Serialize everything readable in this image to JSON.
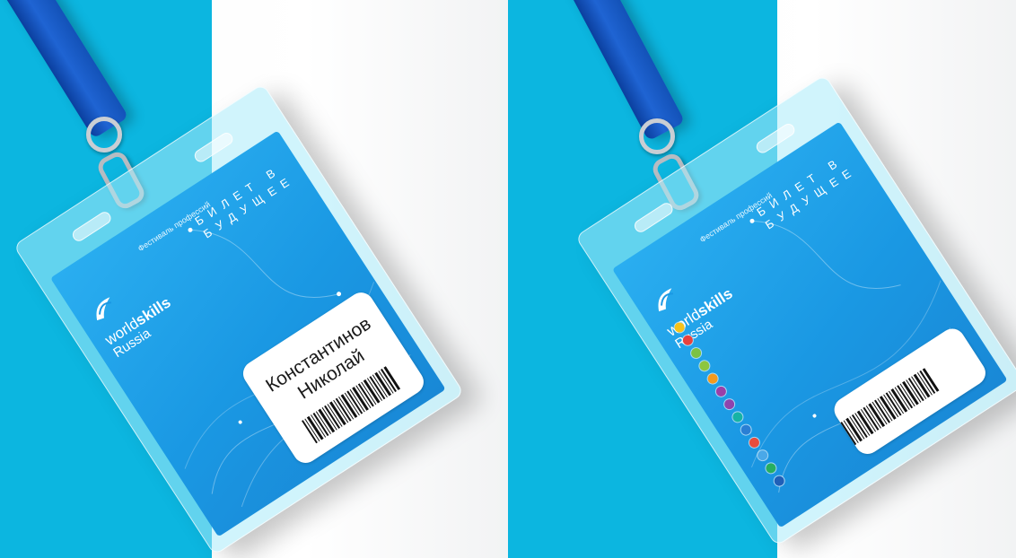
{
  "badges": [
    {
      "org_name_light": "world",
      "org_name_bold": "skills",
      "org_country": "Russia",
      "festival_text": "Фестиваль профессий",
      "ticket_line1": "БИЛЕТ В",
      "ticket_line2": "БУДУЩЕЕ",
      "holder_last_name": "Константинов",
      "holder_first_name": "Николай"
    },
    {
      "org_name_light": "world",
      "org_name_bold": "skills",
      "org_country": "Russia",
      "festival_text": "Фестиваль профессий",
      "ticket_line1": "БИЛЕТ В",
      "ticket_line2": "БУДУЩЕЕ",
      "skill_icons": [
        "yellow-circle-icon",
        "red-circle-icon",
        "green-circle-icon",
        "lime-circle-icon",
        "orange-circle-icon",
        "purple-circle-icon",
        "violet-circle-icon",
        "teal-circle-icon",
        "blue-circle-icon",
        "red-orange-circle-icon",
        "light-blue-circle-icon",
        "green-teal-circle-icon",
        "navy-circle-icon"
      ],
      "skill_colors": [
        "#f6c21b",
        "#e8423d",
        "#7cc242",
        "#8dc63f",
        "#f39a1e",
        "#9b3fa8",
        "#8e44ad",
        "#16b3a4",
        "#2a7fd4",
        "#e74c3c",
        "#4aa8e8",
        "#27ae60",
        "#1f5fb8"
      ]
    }
  ],
  "colors": {
    "cyan_band": "#0cb6e0",
    "card_blue": "#1a98e3",
    "lanyard_blue": "#1f64d3"
  }
}
